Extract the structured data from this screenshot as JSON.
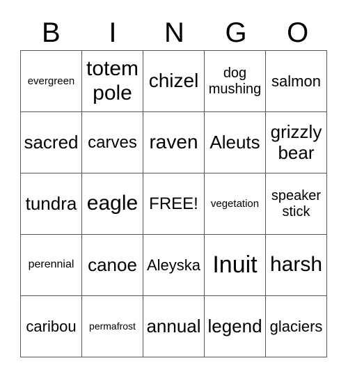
{
  "header": [
    "B",
    "I",
    "N",
    "G",
    "O"
  ],
  "rows": [
    [
      "evergreen",
      "totem pole",
      "chizel",
      "dog mushing",
      "salmon"
    ],
    [
      "sacred",
      "carves",
      "raven",
      "Aleuts",
      "grizzly bear"
    ],
    [
      "tundra",
      "eagle",
      "FREE!",
      "vegetation",
      "speaker stick"
    ],
    [
      "perennial",
      "canoe",
      "Aleyska",
      "Inuit",
      "harsh"
    ],
    [
      "caribou",
      "permafrost",
      "annual",
      "legend",
      "glaciers"
    ]
  ]
}
